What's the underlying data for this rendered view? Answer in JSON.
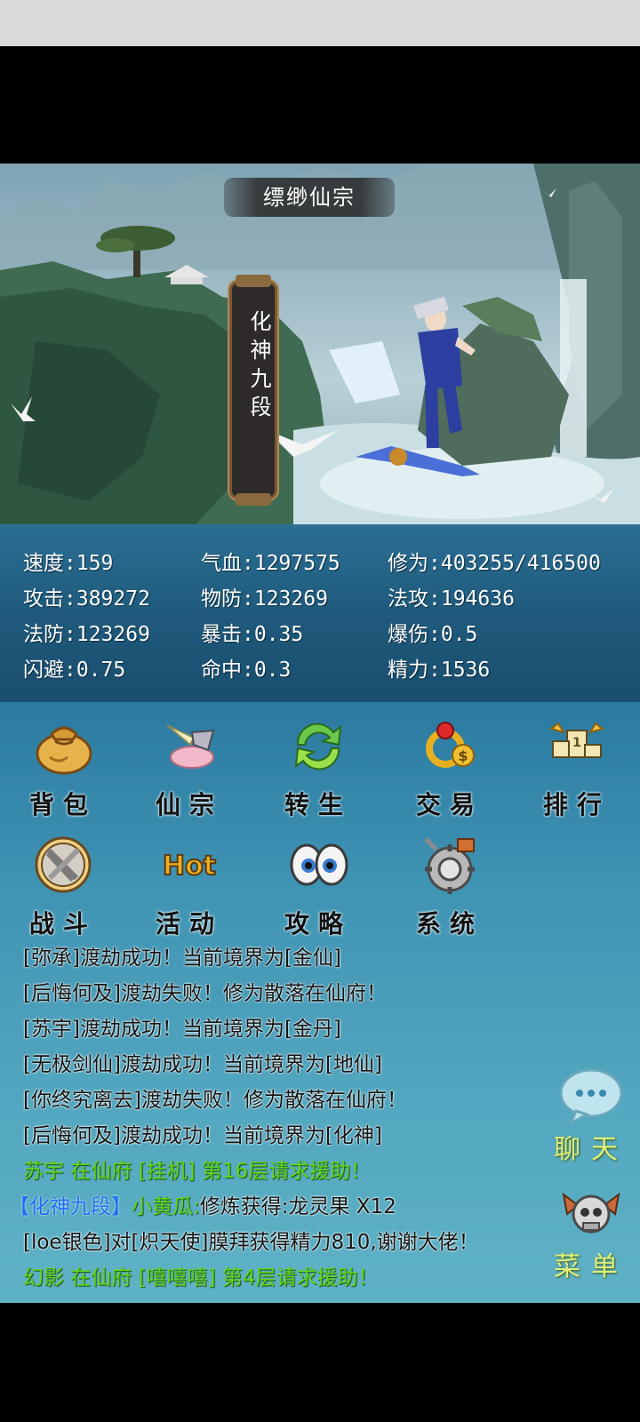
{
  "scene": {
    "location": "缥缈仙宗",
    "rank": "化神九段"
  },
  "stats": {
    "speed": "速度:159",
    "hp": "气血:1297575",
    "cultivation": "修为:403255/416500",
    "attack": "攻击:389272",
    "phys_def": "物防:123269",
    "magic_atk": "法攻:194636",
    "magic_def": "法防:123269",
    "crit": "暴击:0.35",
    "crit_dmg": "爆伤:0.5",
    "dodge": "闪避:0.75",
    "hit": "命中:0.3",
    "energy": "精力:1536"
  },
  "menu": {
    "bag": "背包",
    "sect": "仙宗",
    "rebirth": "转生",
    "trade": "交易",
    "ranking": "排行",
    "battle": "战斗",
    "events": "活动",
    "guide": "攻略",
    "system": "系统",
    "hot_badge": "Hot"
  },
  "chat": [
    "[弥承]渡劫成功！当前境界为[金仙]",
    "[后悔何及]渡劫失败！修为散落在仙府！",
    "[苏宇]渡劫成功！当前境界为[金丹]",
    "[无极剑仙]渡劫成功！当前境界为[地仙]",
    "[你终究离去]渡劫失败！修为散落在仙府！",
    "[后悔何及]渡劫成功！当前境界为[化神]",
    "苏宇 在仙府 [挂机] 第16层请求援助！",
    "修炼获得:龙灵果 X12",
    "[loe银色]对[炽天使]膜拜获得精力810,谢谢大佬！",
    "幻影 在仙府 [嘻嘻嘻] 第4层请求援助！"
  ],
  "chat_extra": {
    "rank_tag": "【化神九段】",
    "player_name": "小黄瓜:"
  },
  "side": {
    "chat": "聊天",
    "menu": "菜单"
  },
  "colors": {
    "system_text": "#141414",
    "green_text": "#5fd61a",
    "blue_tag": "#1c6ef2",
    "side_label": "#dff07a"
  }
}
